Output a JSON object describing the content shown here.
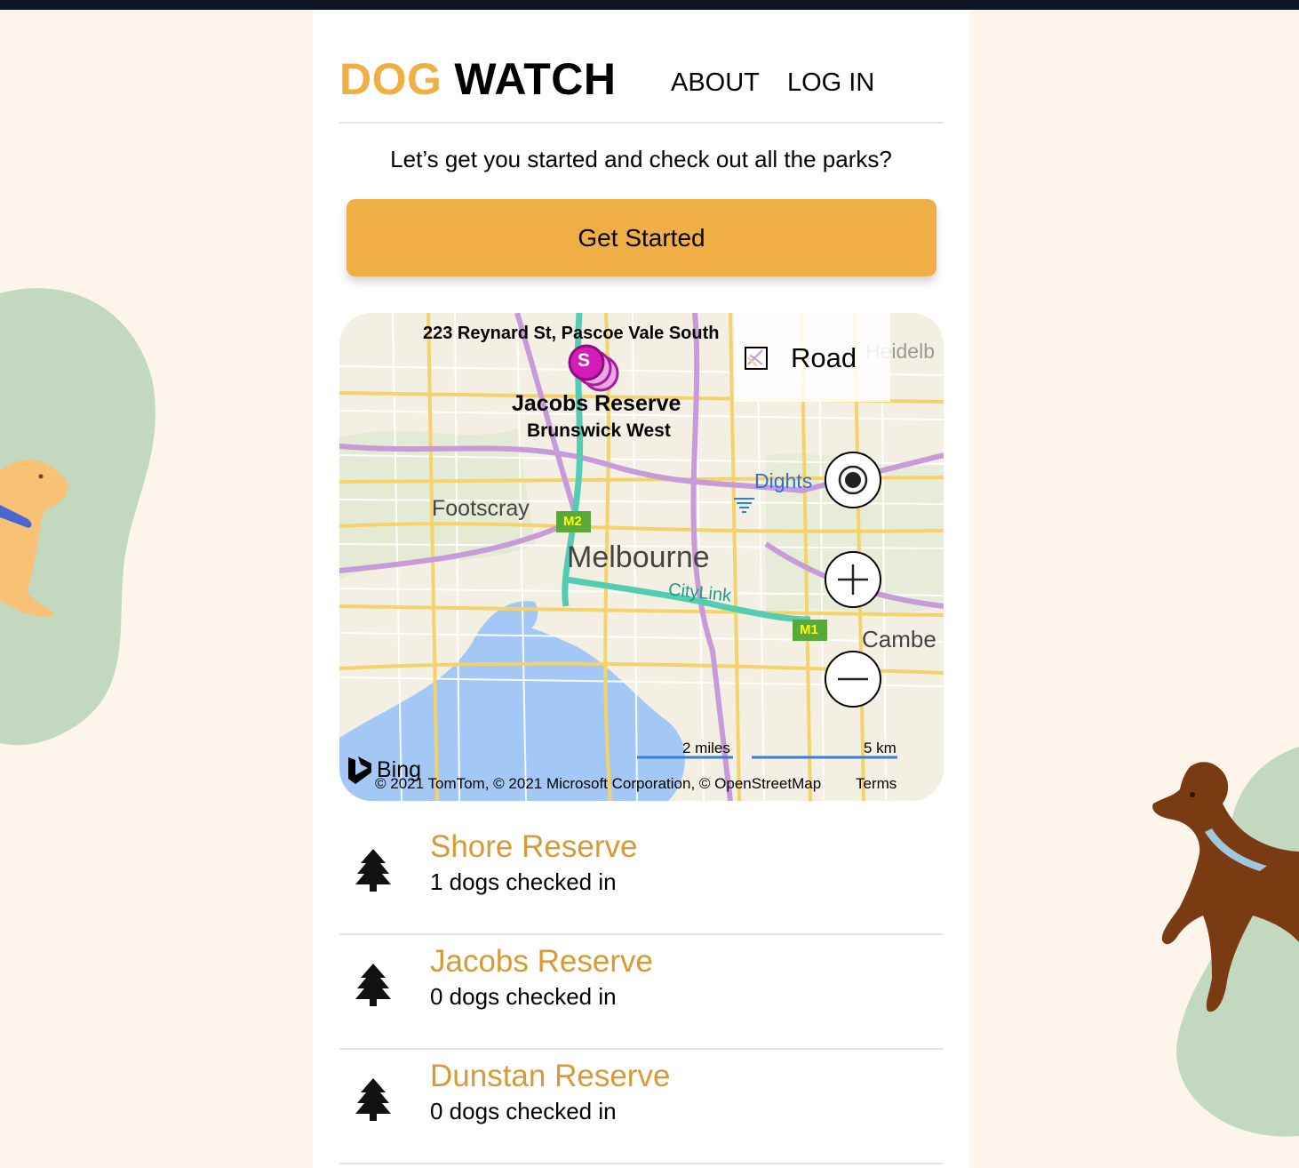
{
  "header": {
    "logo_part1": "DOG",
    "logo_part2": "WATCH",
    "nav": [
      {
        "label": "ABOUT"
      },
      {
        "label": "LOG IN"
      }
    ]
  },
  "intro": {
    "tagline": "Let’s get you started and check out all the parks?",
    "cta_label": "Get Started"
  },
  "map": {
    "address_label": "223 Reynard St, Pascoe Vale South",
    "pin_letter": "S",
    "pin_title": "Jacobs Reserve",
    "pin_subtitle": "Brunswick West",
    "style_selector": "Road",
    "places": {
      "melbourne": "Melbourne",
      "footscray": "Footscray",
      "dights": "Dights",
      "camberwell": "Cambe",
      "heidelberg": "Heidelb",
      "citylink": "CityLink",
      "m2": "M2",
      "m1": "M1"
    },
    "scale": {
      "miles": "2 miles",
      "km": "5 km"
    },
    "bing_logo": "Bing",
    "attribution": "© 2021 TomTom, © 2021 Microsoft Corporation, © OpenStreetMap",
    "terms": "Terms",
    "controls": [
      "locate-me",
      "zoom-in",
      "zoom-out"
    ]
  },
  "parks": [
    {
      "name": "Shore Reserve",
      "checked_in": "1 dogs checked in"
    },
    {
      "name": "Jacobs Reserve",
      "checked_in": "0 dogs checked in"
    },
    {
      "name": "Dunstan Reserve",
      "checked_in": "0 dogs checked in"
    }
  ],
  "colors": {
    "accent": "#efaf45",
    "park_name": "#d79a35",
    "page_bg": "#fdf5ec",
    "deco_green": "#c2d9bf"
  },
  "icons": [
    "tree-icon",
    "layers-icon",
    "locate-icon",
    "plus-icon",
    "minus-icon"
  ]
}
